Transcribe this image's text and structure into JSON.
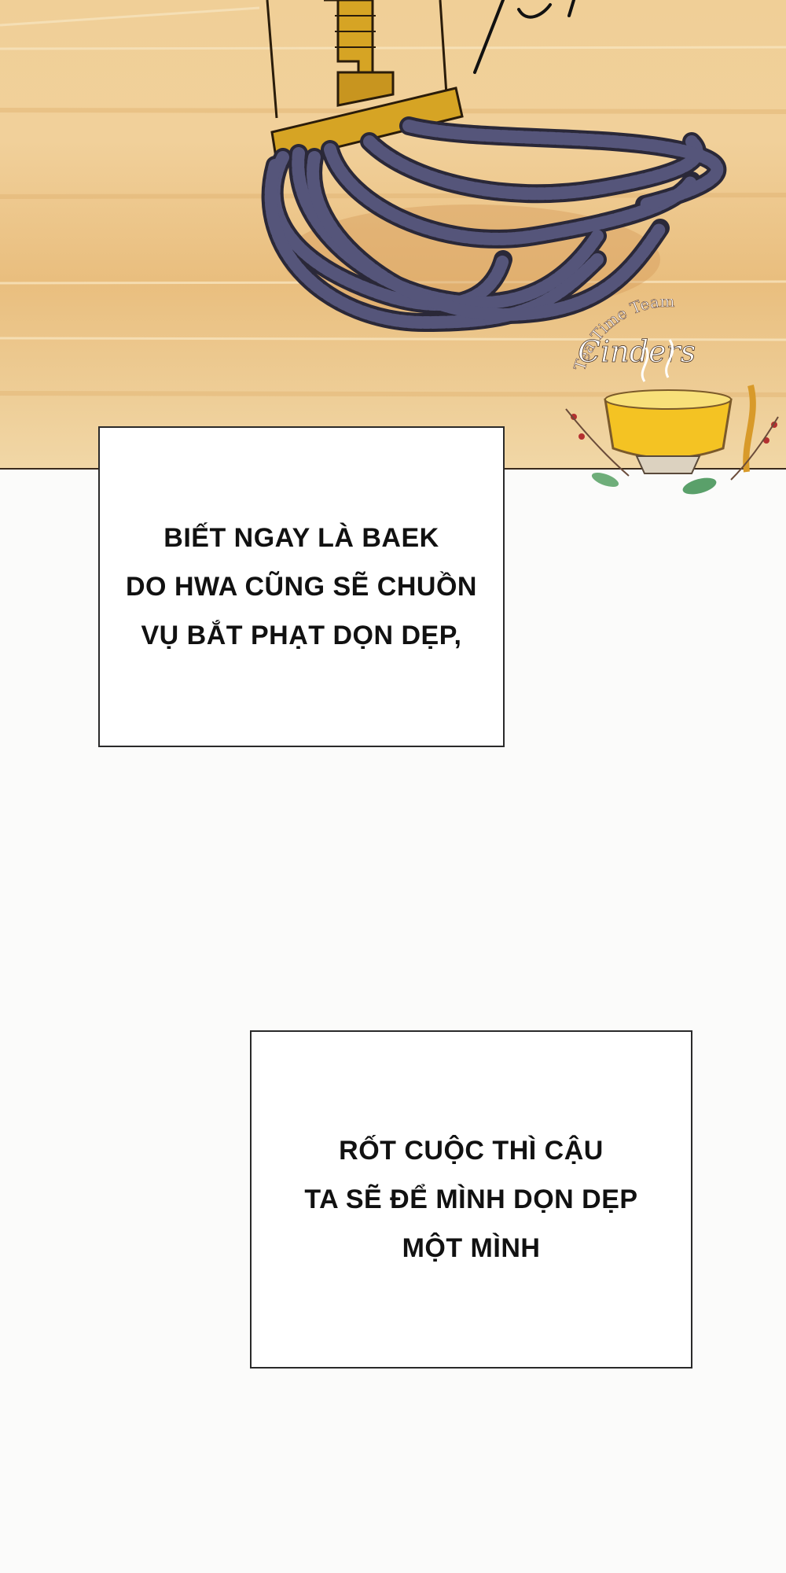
{
  "captions": [
    "BIẾT NGAY LÀ BAEK\nDO HWA CŨNG SẼ CHUỒN\nVỤ BẮT PHẠT DỌN DẸP,",
    "RỐT CUỘC THÌ CẬU\nTA SẼ ĐỂ MÌNH DỌN DẸP\nMỘT MÌNH"
  ],
  "watermark": {
    "team_text": "Tea Time Team",
    "logo_script": "Cinders"
  },
  "colors": {
    "floor": "#eecb92",
    "mop_strands": "#4d4c6a",
    "mop_handle": "#d6a424",
    "tea": "#f4c323"
  }
}
